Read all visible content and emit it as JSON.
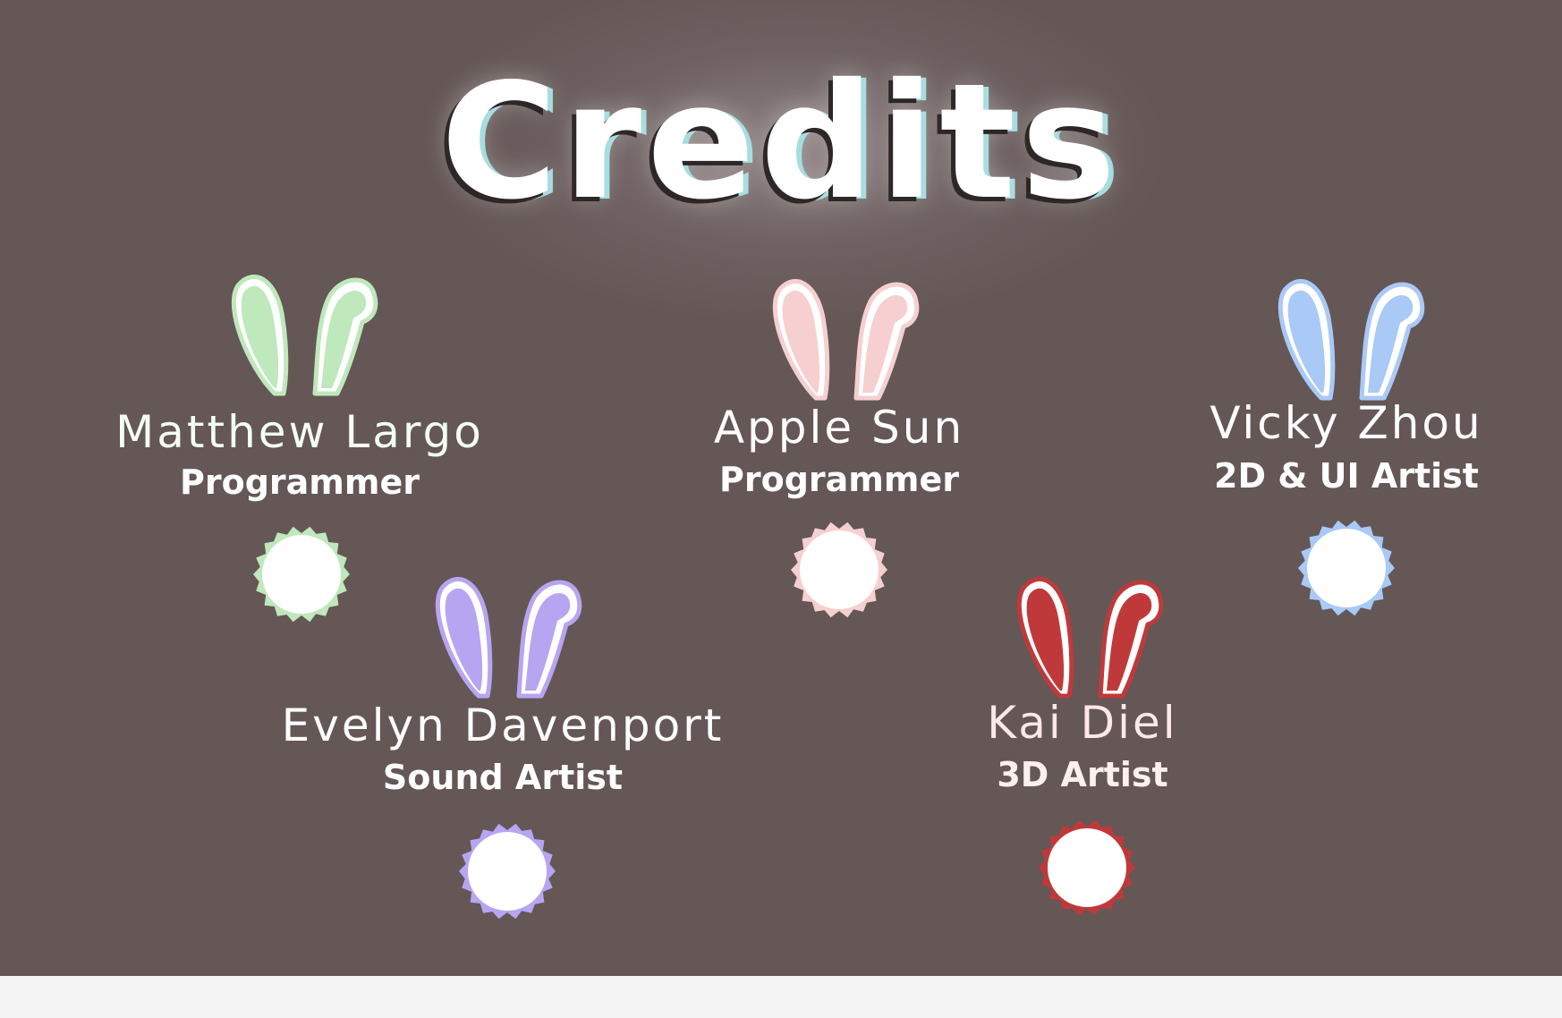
{
  "title": "Credits",
  "members": [
    {
      "name": "Matthew Largo",
      "role": "Programmer",
      "color": "#bfe8bc",
      "outline": "#ffffff",
      "icon": "green-bunny-ears-icon"
    },
    {
      "name": "Apple Sun",
      "role": "Programmer",
      "color": "#f6cfd0",
      "outline": "#ffffff",
      "icon": "pink-bunny-ears-icon"
    },
    {
      "name": "Vicky Zhou",
      "role": "2D & UI Artist",
      "color": "#a9c9f7",
      "outline": "#ffffff",
      "icon": "blue-bunny-ears-icon"
    },
    {
      "name": "Evelyn Davenport",
      "role": "Sound Artist",
      "color": "#b7a5f2",
      "outline": "#ffffff",
      "icon": "purple-bunny-ears-icon"
    },
    {
      "name": "Kai Diel",
      "role": "3D Artist",
      "color": "#c0393a",
      "outline": "#ffffff",
      "icon": "red-bunny-ears-icon"
    }
  ]
}
